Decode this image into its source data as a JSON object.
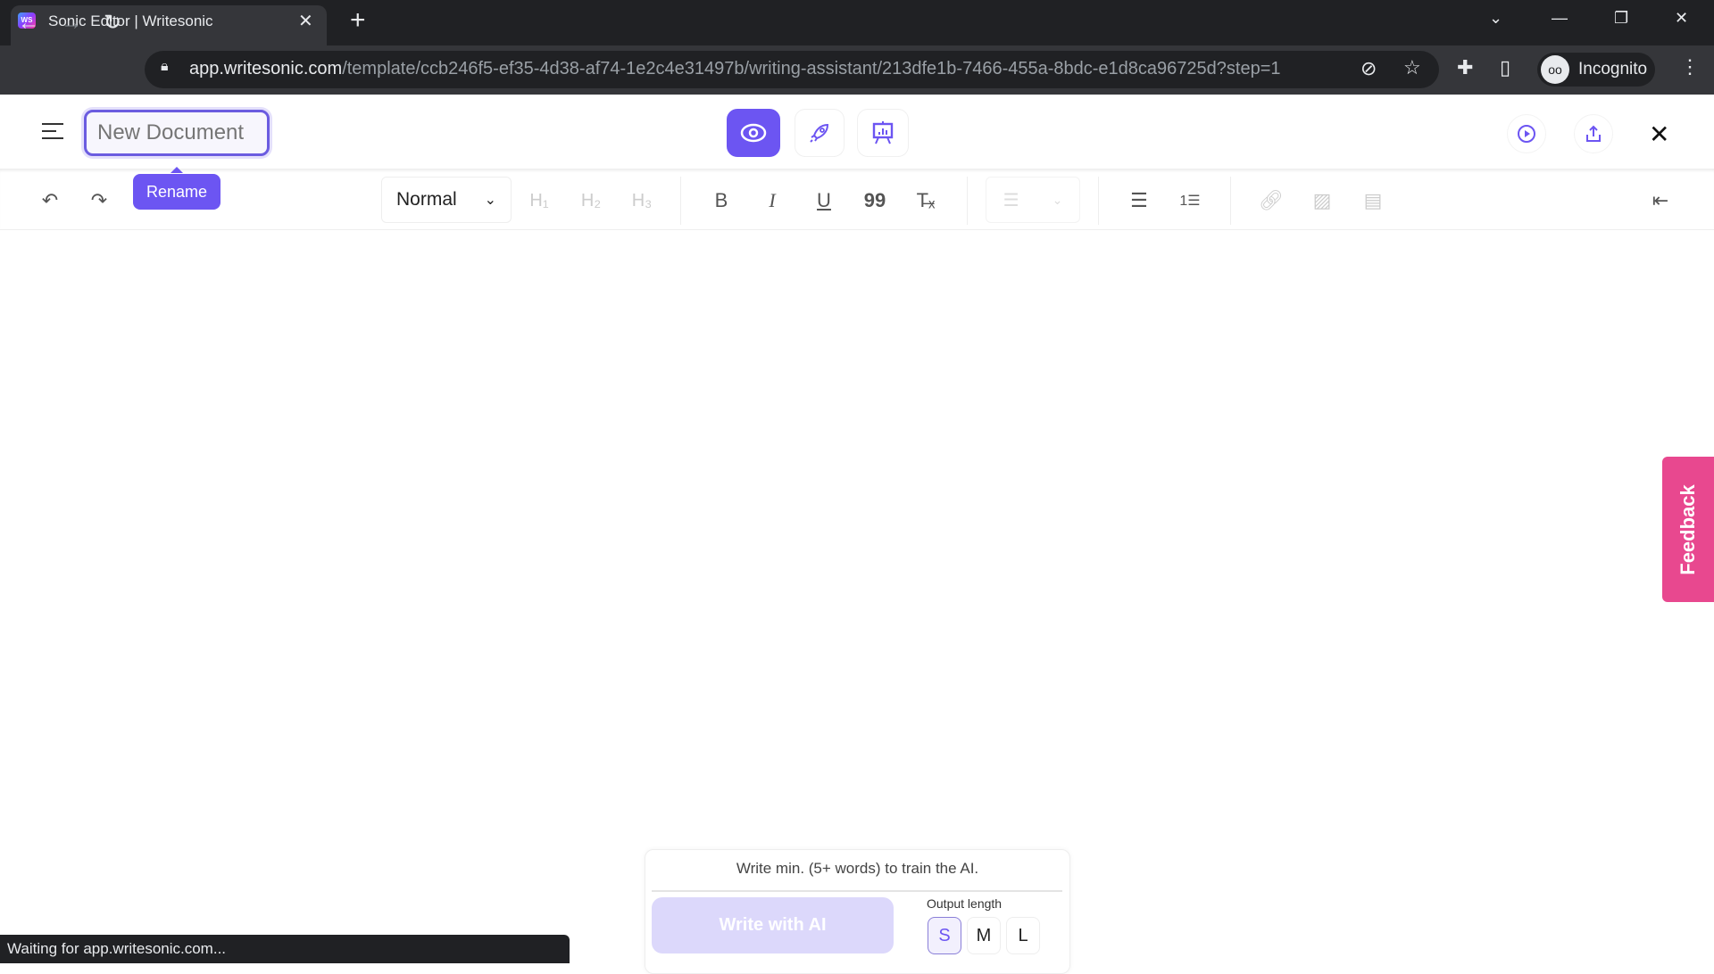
{
  "browser": {
    "tab_title": "Sonic Editor | Writesonic",
    "favicon_text": "WS",
    "url_domain": "app.writesonic.com",
    "url_path": "/template/ccb246f5-ef35-4d38-af74-1e2c4e31497b/writing-assistant/213dfe1b-7466-455a-8bdc-e1d8ca96725d?step=1",
    "profile_label": "Incognito",
    "status_text": "Waiting for app.writesonic.com..."
  },
  "header": {
    "document_name_placeholder": "New Document",
    "rename_tooltip": "Rename",
    "accent_color": "#6c55f2"
  },
  "toolbar": {
    "style_value": "Normal",
    "h1": "H₁",
    "h2": "H₂",
    "h3": "H₃",
    "bold": "B",
    "italic": "I",
    "underline": "U",
    "quote": "99",
    "clear": "T̶ₓ"
  },
  "feedback": {
    "label": "Feedback",
    "color": "#e8488f"
  },
  "ai_panel": {
    "hint": "Write min. (5+ words) to train the AI.",
    "write_button": "Write with AI",
    "output_length_label": "Output length",
    "lengths": [
      "S",
      "M",
      "L"
    ],
    "selected_length": "S"
  }
}
